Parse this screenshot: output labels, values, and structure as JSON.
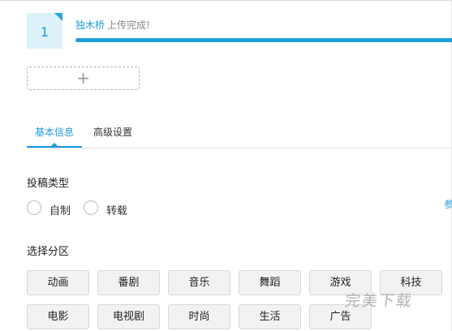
{
  "upload": {
    "thumb_number": "1",
    "file_name": "独木桥",
    "status": "上传完成!",
    "progress_percent": 100,
    "add_icon": "plus-icon"
  },
  "tabs": [
    {
      "label": "基本信息",
      "active": true
    },
    {
      "label": "高级设置",
      "active": false
    }
  ],
  "form": {
    "type_label": "投稿类型",
    "type_options": [
      "自制",
      "转载"
    ],
    "side_char": "参",
    "category_label": "选择分区",
    "categories": [
      [
        "动画",
        "番剧",
        "音乐",
        "舞蹈",
        "游戏",
        "科技"
      ],
      [
        "电影",
        "电视剧",
        "时尚",
        "生活",
        "广告"
      ]
    ]
  },
  "watermark": "完美下载",
  "colors": {
    "accent": "#1e9bd6",
    "thumb_bg": "#ddf1fb",
    "button_bg": "#f2f2f2"
  }
}
